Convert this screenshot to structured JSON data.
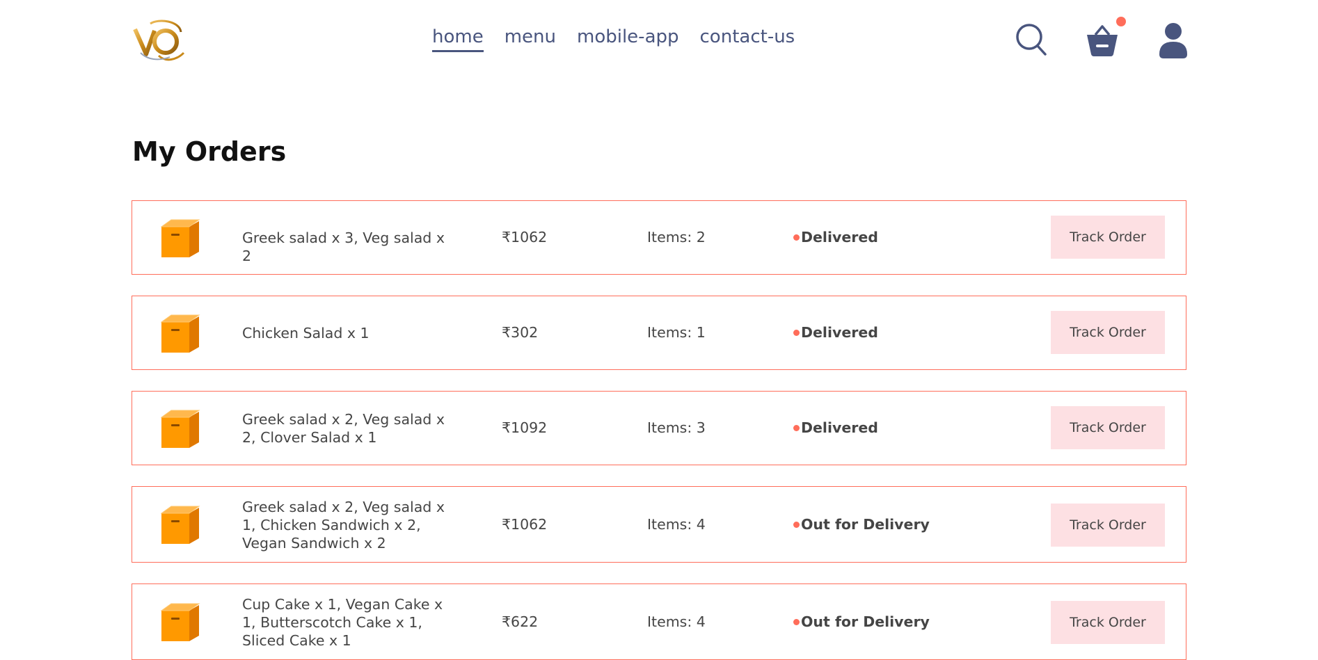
{
  "brand": {
    "logo_text": "VQ"
  },
  "nav": {
    "links": [
      {
        "label": "home",
        "active": true
      },
      {
        "label": "menu",
        "active": false
      },
      {
        "label": "mobile-app",
        "active": false
      },
      {
        "label": "contact-us",
        "active": false
      }
    ],
    "icons": [
      "search-icon",
      "basket-icon",
      "profile-icon"
    ],
    "cart_has_items": true
  },
  "page": {
    "title": "My Orders"
  },
  "colors": {
    "text": "#49557e",
    "accent": "#ff6d5a",
    "button_bg": "#fde0e3",
    "parcel": "#ff9900"
  },
  "orders": [
    {
      "items": "Greek salad x 3, Veg salad x 2",
      "amount": "₹1062",
      "count": "Items: 2",
      "status": "Delivered",
      "button": "Track Order"
    },
    {
      "items": "Chicken Salad x 1",
      "amount": "₹302",
      "count": "Items: 1",
      "status": "Delivered",
      "button": "Track Order"
    },
    {
      "items": "Greek salad x 2, Veg salad x 2, Clover Salad x 1",
      "amount": "₹1092",
      "count": "Items: 3",
      "status": "Delivered",
      "button": "Track Order"
    },
    {
      "items": "Greek salad x 2, Veg salad x 1, Chicken Sandwich x 2, Vegan Sandwich x 2",
      "amount": "₹1062",
      "count": "Items: 4",
      "status": "Out for Delivery",
      "button": "Track Order"
    },
    {
      "items": "Cup Cake x 1, Vegan Cake x 1, Butterscotch Cake x 1, Sliced Cake x 1",
      "amount": "₹622",
      "count": "Items: 4",
      "status": "Out for Delivery",
      "button": "Track Order"
    }
  ]
}
